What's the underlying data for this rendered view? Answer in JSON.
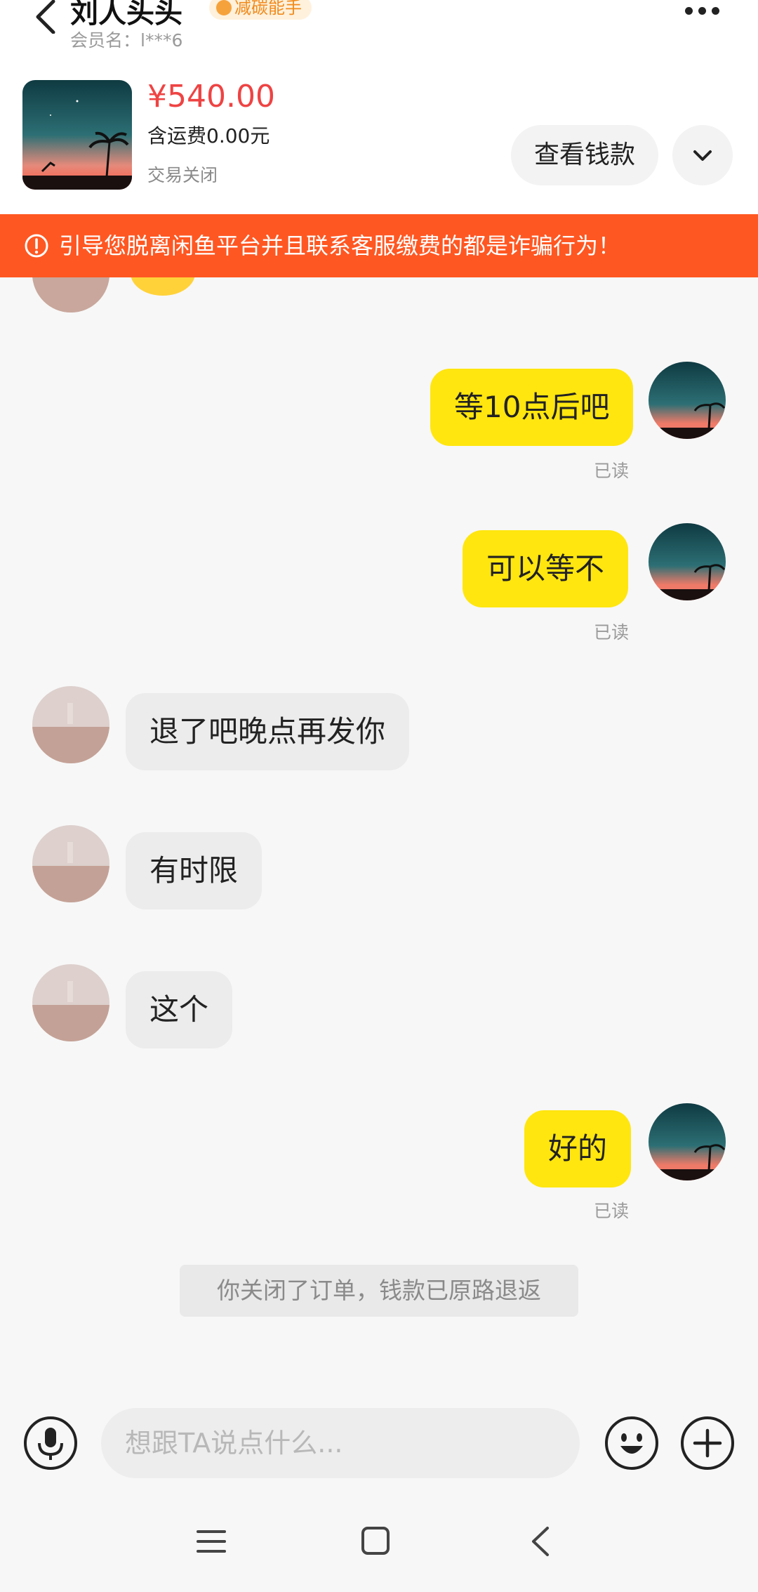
{
  "header": {
    "contact_name": "刘人头头",
    "badge_label": "减碳能手",
    "member_id": "会员名：l***6",
    "more_icon": "more-dots-icon"
  },
  "order": {
    "price": "¥540.00",
    "shipping": "含运费0.00元",
    "status": "交易关闭",
    "view_payment_label": "查看钱款",
    "expand_icon": "chevron-down-icon"
  },
  "warning": {
    "text": "引导您脱离闲鱼平台并且联系客服缴费的都是诈骗行为！",
    "color": "#ff5722"
  },
  "messages": [
    {
      "from": "me",
      "text": "等10点后吧",
      "read": "已读"
    },
    {
      "from": "me",
      "text": "可以等不",
      "read": "已读"
    },
    {
      "from": "them",
      "text": "退了吧晚点再发你"
    },
    {
      "from": "them",
      "text": "有时限"
    },
    {
      "from": "them",
      "text": "这个"
    },
    {
      "from": "me",
      "text": "好的",
      "read": "已读"
    }
  ],
  "system_note": "你关闭了订单，钱款已原路退返",
  "input": {
    "placeholder": "想跟TA说点什么..."
  },
  "colors": {
    "accent_yellow": "#ffe60f",
    "price_red": "#ef4343",
    "banner_orange": "#ff5722"
  }
}
